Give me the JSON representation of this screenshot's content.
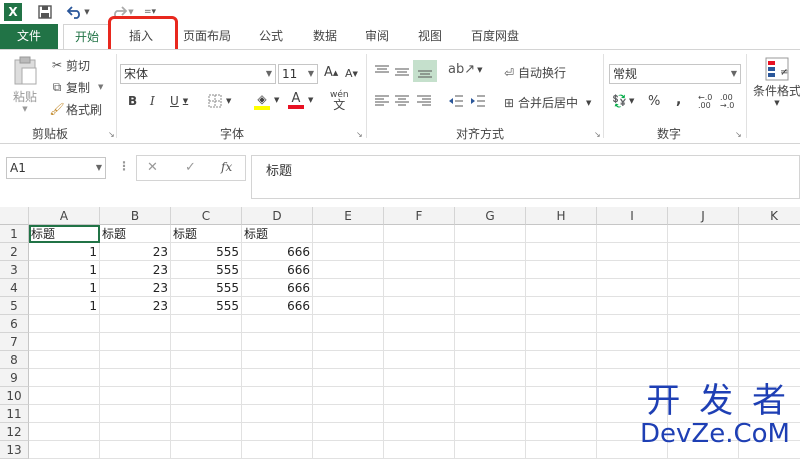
{
  "app": {
    "logo": "X"
  },
  "qat": {
    "save_icon": "save-icon",
    "undo_icon": "undo-icon",
    "redo_icon": "redo-icon",
    "customize_icon": "customize-icon"
  },
  "tabs": [
    {
      "label": "文件"
    },
    {
      "label": "开始"
    },
    {
      "label": "插入"
    },
    {
      "label": "页面布局"
    },
    {
      "label": "公式"
    },
    {
      "label": "数据"
    },
    {
      "label": "审阅"
    },
    {
      "label": "视图"
    },
    {
      "label": "百度网盘"
    }
  ],
  "ribbon": {
    "clipboard": {
      "paste": "粘贴",
      "cut": "剪切",
      "copy": "复制",
      "format_painter": "格式刷",
      "group": "剪贴板"
    },
    "font": {
      "family": "宋体",
      "size": "11",
      "bold": "B",
      "italic": "I",
      "underline": "U",
      "grow": "A",
      "shrink": "A",
      "phonetic": "wén",
      "group": "字体",
      "fill_color": "#ffff00",
      "font_color": "#e81123"
    },
    "alignment": {
      "wrap": "自动换行",
      "merge": "合并后居中",
      "group": "对齐方式"
    },
    "number": {
      "format": "常规",
      "percent": "%",
      "comma": ",",
      "group": "数字"
    },
    "styles": {
      "conditional": "条件格式"
    }
  },
  "formula_bar": {
    "name_box": "A1",
    "cancel": "✕",
    "enter": "✓",
    "fx": "fx",
    "content": "标题"
  },
  "columns": [
    "A",
    "B",
    "C",
    "D",
    "E",
    "F",
    "G",
    "H",
    "I",
    "J",
    "K"
  ],
  "rows": [
    "1",
    "2",
    "3",
    "4",
    "5",
    "6",
    "7",
    "8",
    "9",
    "10",
    "11",
    "12",
    "13"
  ],
  "cells": [
    [
      "标题",
      "标题",
      "标题",
      "标题"
    ],
    [
      "1",
      "23",
      "555",
      "666"
    ],
    [
      "1",
      "23",
      "555",
      "666"
    ],
    [
      "1",
      "23",
      "555",
      "666"
    ],
    [
      "1",
      "23",
      "555",
      "666"
    ]
  ],
  "watermark": {
    "line1": "开 发 者",
    "line2": "DevZe.CoM"
  }
}
